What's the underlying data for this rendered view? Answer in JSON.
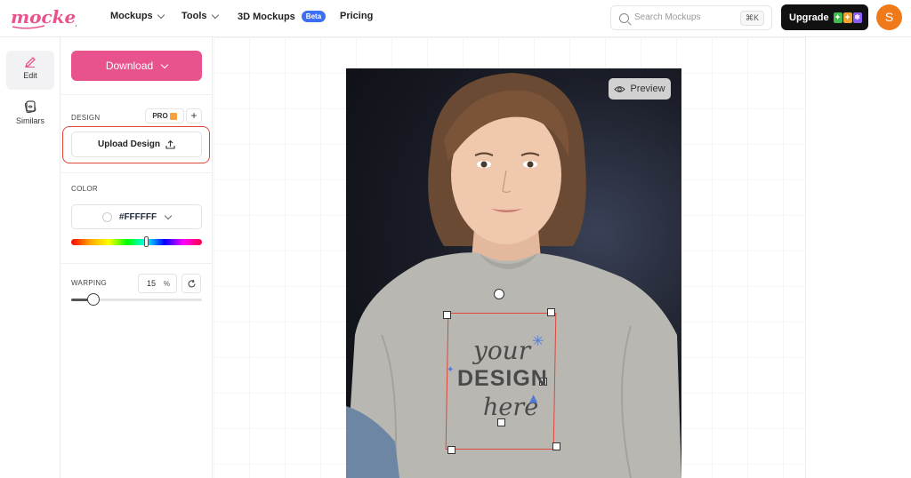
{
  "header": {
    "logo_text": "mockey",
    "nav": [
      {
        "label": "Mockups"
      },
      {
        "label": "Tools"
      },
      {
        "label": "3D Mockups",
        "badge": "Beta"
      },
      {
        "label": "Pricing"
      }
    ],
    "search": {
      "placeholder": "Search Mockups",
      "shortcut": "⌘K"
    },
    "upgrade_label": "Upgrade",
    "avatar_initial": "S"
  },
  "rail": {
    "items": [
      {
        "label": "Edit",
        "icon": "pencil-icon",
        "active": true
      },
      {
        "label": "Similars",
        "icon": "similar-icon",
        "active": false
      }
    ]
  },
  "panel": {
    "download_label": "Download",
    "design": {
      "label": "DESIGN",
      "pro_label": "PRO",
      "upload_label": "Upload Design"
    },
    "color": {
      "label": "COLOR",
      "value": "#FFFFFF"
    },
    "warping": {
      "label": "WARPING",
      "value": "15",
      "unit": "%",
      "level": 0.15
    }
  },
  "canvas": {
    "preview_label": "Preview",
    "design_lines": [
      "your",
      "DESIGN",
      "here"
    ]
  },
  "colors": {
    "accent": "#e8538e",
    "selection": "#e0463a",
    "avatar": "#f07a1a",
    "beta": "#3b6ff5"
  }
}
